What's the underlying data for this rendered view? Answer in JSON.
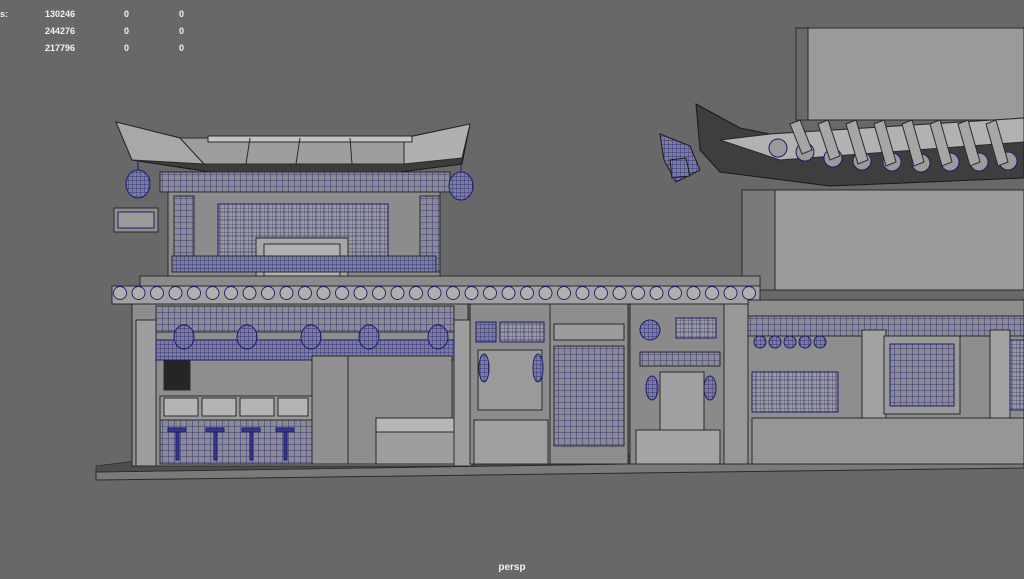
{
  "hud": {
    "rows": [
      {
        "label": "s:",
        "a": "130246",
        "b": "0",
        "c": "0"
      },
      {
        "label": "",
        "a": "244276",
        "b": "0",
        "c": "0"
      },
      {
        "label": "",
        "a": "217796",
        "b": "0",
        "c": "0"
      }
    ]
  },
  "camera": {
    "name": "persp"
  },
  "colors": {
    "background": "#686868",
    "surface": "#8e8e8e",
    "surface_light": "#a9a9a9",
    "surface_dark": "#4a4a4a",
    "wire": "#1b1b6e",
    "edge": "#2a2a2a"
  }
}
